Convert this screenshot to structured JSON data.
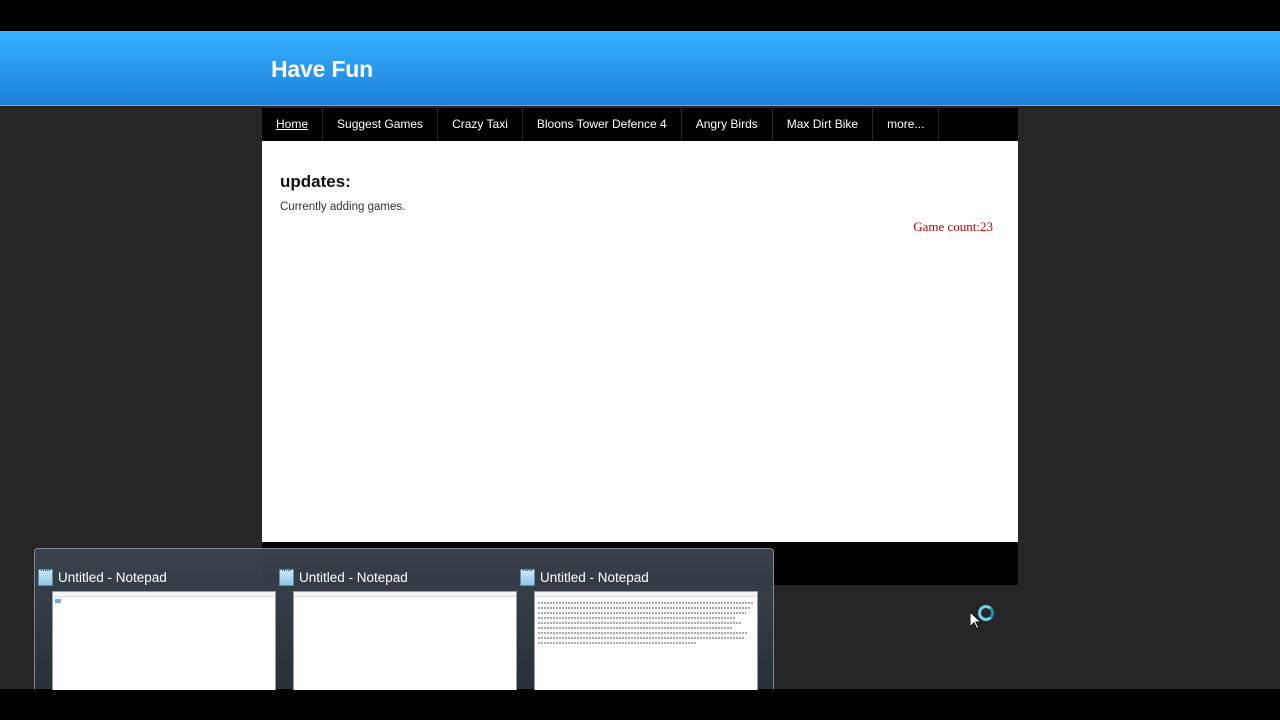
{
  "site": {
    "title": "Have Fun",
    "nav": [
      {
        "label": "Home"
      },
      {
        "label": "Suggest Games"
      },
      {
        "label": "Crazy Taxi"
      },
      {
        "label": "Bloons Tower Defence 4"
      },
      {
        "label": "Angry Birds"
      },
      {
        "label": "Max Dirt Bike"
      },
      {
        "label": "more..."
      }
    ],
    "content": {
      "heading": "updates:",
      "text": "Currently adding games.",
      "game_count": "Game count:23"
    }
  },
  "taskbar_preview": {
    "thumbnails": [
      {
        "title": "Untitled - Notepad",
        "icon": "notepad-icon"
      },
      {
        "title": "Untitled - Notepad",
        "icon": "notepad-icon"
      },
      {
        "title": "Untitled - Notepad",
        "icon": "notepad-icon"
      }
    ]
  },
  "colors": {
    "header_blue": "#2997ec",
    "count_red": "#cc0000",
    "page_bg": "#262626"
  }
}
